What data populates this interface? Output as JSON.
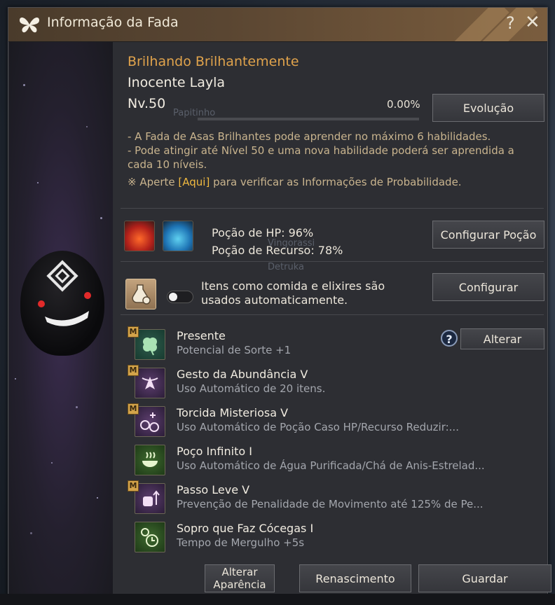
{
  "window": {
    "title": "Informação da Fada"
  },
  "fairy": {
    "subtitle": "Brilhando Brilhantemente",
    "name": "Inocente Layla",
    "level": "Nv.50",
    "exp_percent": "0.00%",
    "exp_fill": 0,
    "evolution_button": "Evolução"
  },
  "description": {
    "line1": "- A Fada de Asas Brilhantes pode aprender no máximo 6 habilidades.",
    "line2": "- Pode atingir até Nível 50 e uma nova habilidade poderá ser aprendida a cada 10 níveis.",
    "probability_prefix": "※ Aperte ",
    "probability_link": "[Aqui]",
    "probability_suffix": " para verificar as Informações de Probabilidade."
  },
  "potions": {
    "hp_label": "Poção de HP: 96%",
    "resource_label": "Poção de Recurso: 78%",
    "configure_button": "Configurar Poção"
  },
  "auto_items": {
    "text": "Itens como comida e elixires são usados automaticamente.",
    "configure_button": "Configurar",
    "toggle_on": false
  },
  "skills_header": {
    "change_button": "Alterar"
  },
  "skills": [
    {
      "badge": "M",
      "name": "Presente",
      "desc": "Potencial de Sorte +1",
      "icon": "clover-icon"
    },
    {
      "badge": "M",
      "name": "Gesto da Abundância V",
      "desc": "Uso Automático de 20 itens.",
      "icon": "fairy-icon"
    },
    {
      "badge": "M",
      "name": "Torcida Misteriosa V",
      "desc": "Uso Automático de Poção Caso HP/Recurso Reduzir:...",
      "icon": "potion-cheer-icon"
    },
    {
      "badge": "",
      "name": "Poço Infinito I",
      "desc": "Uso Automático de Água Purificada/Chá de Anis-Estrelad...",
      "icon": "bowl-icon"
    },
    {
      "badge": "M",
      "name": "Passo Leve V",
      "desc": "Prevenção de Penalidade de Movimento até 125% de Pe...",
      "icon": "bag-arrow-icon"
    },
    {
      "badge": "",
      "name": "Sopro que Faz Cócegas I",
      "desc": "Tempo de Mergulho +5s",
      "icon": "bubble-timer-icon"
    }
  ],
  "footer": {
    "change_appearance_line1": "Alterar",
    "change_appearance_line2": "Aparência",
    "rebirth_button": "Renascimento",
    "save_button": "Guardar"
  },
  "background_ghost_text": {
    "t1": "Papitinho",
    "t2": "Vingorassi",
    "t3": "Detruka"
  },
  "colors": {
    "accent_gold": "#e0a34c",
    "link_yellow": "#f0b940",
    "desc_tan": "#c9b48e"
  }
}
